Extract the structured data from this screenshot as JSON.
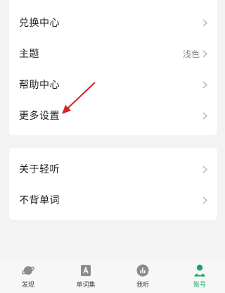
{
  "settings_group_1": [
    {
      "label": "兑换中心",
      "value": ""
    },
    {
      "label": "主题",
      "value": "浅色"
    },
    {
      "label": "帮助中心",
      "value": ""
    },
    {
      "label": "更多设置",
      "value": ""
    }
  ],
  "settings_group_2": [
    {
      "label": "关于轻听"
    },
    {
      "label": "不背单词"
    }
  ],
  "tabbar": {
    "tabs": [
      {
        "label": "发现",
        "icon": "planet-icon"
      },
      {
        "label": "单词集",
        "icon": "word-book-icon"
      },
      {
        "label": "我听",
        "icon": "audio-bars-icon"
      },
      {
        "label": "账号",
        "icon": "account-icon"
      }
    ],
    "active_index": 3
  },
  "colors": {
    "accent_green": "#1aa56a",
    "annotation_red": "#d42424",
    "background": "#f3f3f3"
  }
}
